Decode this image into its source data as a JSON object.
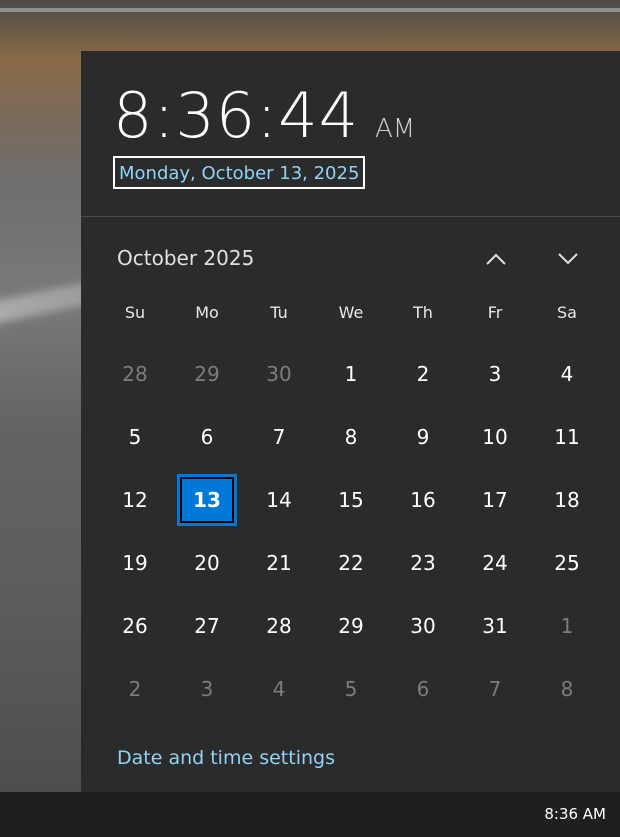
{
  "clock": {
    "time": "8:36:44",
    "ampm": "AM",
    "date": "Monday, October 13, 2025"
  },
  "calendar": {
    "month_label": "October 2025",
    "weekdays": [
      "Su",
      "Mo",
      "Tu",
      "We",
      "Th",
      "Fr",
      "Sa"
    ],
    "weeks": [
      [
        {
          "d": "28",
          "o": true
        },
        {
          "d": "29",
          "o": true
        },
        {
          "d": "30",
          "o": true
        },
        {
          "d": "1"
        },
        {
          "d": "2"
        },
        {
          "d": "3"
        },
        {
          "d": "4"
        }
      ],
      [
        {
          "d": "5"
        },
        {
          "d": "6"
        },
        {
          "d": "7"
        },
        {
          "d": "8"
        },
        {
          "d": "9"
        },
        {
          "d": "10"
        },
        {
          "d": "11"
        }
      ],
      [
        {
          "d": "12"
        },
        {
          "d": "13",
          "today": true
        },
        {
          "d": "14"
        },
        {
          "d": "15"
        },
        {
          "d": "16"
        },
        {
          "d": "17"
        },
        {
          "d": "18"
        }
      ],
      [
        {
          "d": "19"
        },
        {
          "d": "20"
        },
        {
          "d": "21"
        },
        {
          "d": "22"
        },
        {
          "d": "23"
        },
        {
          "d": "24"
        },
        {
          "d": "25"
        }
      ],
      [
        {
          "d": "26"
        },
        {
          "d": "27"
        },
        {
          "d": "28"
        },
        {
          "d": "29"
        },
        {
          "d": "30"
        },
        {
          "d": "31"
        },
        {
          "d": "1",
          "o": true
        }
      ],
      [
        {
          "d": "2",
          "o": true
        },
        {
          "d": "3",
          "o": true
        },
        {
          "d": "4",
          "o": true
        },
        {
          "d": "5",
          "o": true
        },
        {
          "d": "6",
          "o": true
        },
        {
          "d": "7",
          "o": true
        },
        {
          "d": "8",
          "o": true
        }
      ]
    ],
    "nav_icons": {
      "prev": "chevron-up-icon",
      "next": "chevron-down-icon"
    }
  },
  "settings_link": "Date and time settings",
  "taskbar": {
    "clock": "8:36 AM"
  },
  "colors": {
    "flyout_bg": "#2b2b2b",
    "accent": "#0078d7",
    "link": "#8fd3f7",
    "muted_day": "#7c7c7c",
    "taskbar_bg": "#1f1f1f"
  }
}
